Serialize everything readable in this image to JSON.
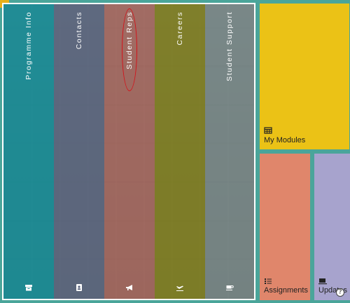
{
  "nav_columns": [
    {
      "label": "Programme Info",
      "icon": "archive-icon",
      "color": "#168c96"
    },
    {
      "label": "Contacts",
      "icon": "contact-card-icon",
      "color": "#5a647d"
    },
    {
      "label": "Student Reps",
      "icon": "megaphone-icon",
      "color": "#aa645a"
    },
    {
      "label": "Careers",
      "icon": "airplane-icon",
      "color": "#807d1e"
    },
    {
      "label": "Student Support",
      "icon": "coffee-cup-icon",
      "color": "#788787"
    }
  ],
  "tiles": {
    "modules": {
      "label": "My Modules",
      "icon": "table-icon",
      "color": "#ebc216"
    },
    "assignments": {
      "label": "Assignments",
      "icon": "checklist-icon",
      "color": "#e0866b"
    },
    "updates": {
      "label": "Updates",
      "icon": "laptop-coffee-icon",
      "color": "#a7a3cd"
    }
  },
  "help": {
    "symbol": "?"
  }
}
